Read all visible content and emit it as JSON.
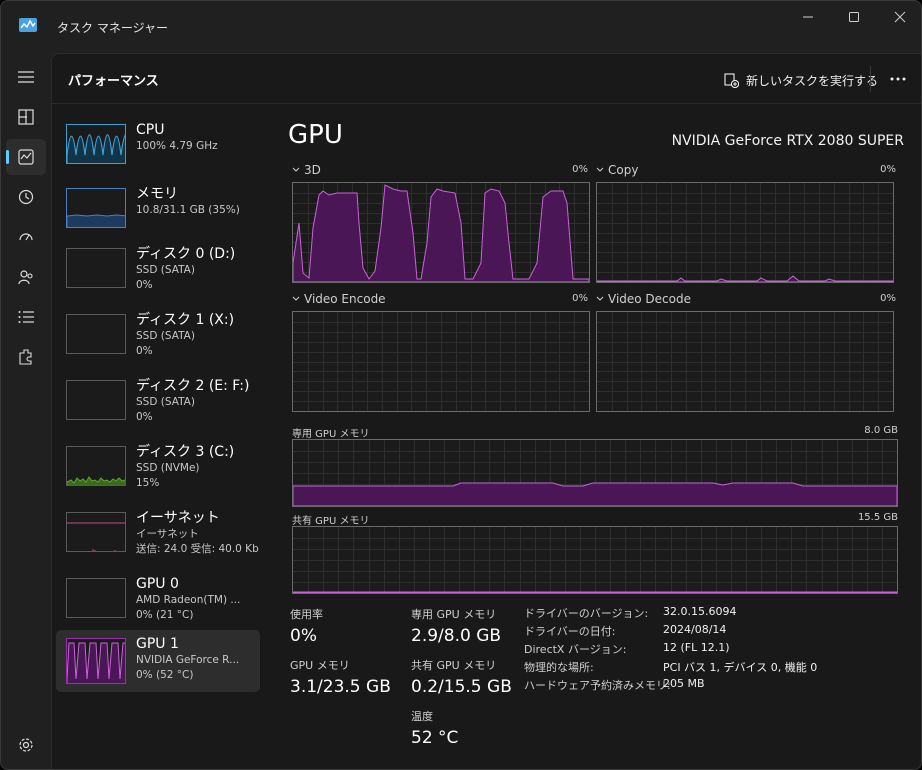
{
  "window": {
    "title": "タスク マネージャー",
    "controls": [
      "minimize-icon",
      "maximize-icon",
      "close-icon"
    ]
  },
  "nav": {
    "items": [
      "hamburger-icon",
      "processes-icon",
      "performance-icon",
      "app-history-icon",
      "startup-apps-icon",
      "users-icon",
      "details-icon",
      "services-icon"
    ],
    "settings": "settings-icon",
    "active": "performance-icon"
  },
  "header": {
    "title": "パフォーマンス",
    "run_task": "新しいタスクを実行する"
  },
  "sidebar": {
    "items": [
      {
        "name": "CPU",
        "sub1": "100%  4.79 GHz",
        "sub2": "",
        "sub3": ""
      },
      {
        "name": "メモリ",
        "sub1": "10.8/31.1 GB (35%)",
        "sub2": "",
        "sub3": ""
      },
      {
        "name": "ディスク 0 (D:)",
        "sub1": "SSD (SATA)",
        "sub2": "0%",
        "sub3": ""
      },
      {
        "name": "ディスク 1 (X:)",
        "sub1": "SSD (SATA)",
        "sub2": "0%",
        "sub3": ""
      },
      {
        "name": "ディスク 2 (E: F:)",
        "sub1": "SSD (SATA)",
        "sub2": "0%",
        "sub3": ""
      },
      {
        "name": "ディスク 3 (C:)",
        "sub1": "SSD (NVMe)",
        "sub2": "15%",
        "sub3": ""
      },
      {
        "name": "イーサネット",
        "sub1": "イーサネット",
        "sub2": "送信: 24.0  受信: 40.0 Kb",
        "sub3": ""
      },
      {
        "name": "GPU 0",
        "sub1": "AMD Radeon(TM) ...",
        "sub2": "0%  (21 °C)",
        "sub3": ""
      },
      {
        "name": "GPU 1",
        "sub1": "NVIDIA GeForce R...",
        "sub2": "0%  (52 °C)",
        "sub3": ""
      }
    ]
  },
  "main": {
    "title": "GPU",
    "model": "NVIDIA GeForce RTX 2080 SUPER",
    "engines": [
      {
        "label": "3D",
        "pct": "0%"
      },
      {
        "label": "Copy",
        "pct": "0%"
      },
      {
        "label": "Video Encode",
        "pct": "0%"
      },
      {
        "label": "Video Decode",
        "pct": "0%"
      }
    ],
    "dedicated": {
      "label": "専用 GPU メモリ",
      "max": "8.0 GB"
    },
    "shared": {
      "label": "共有 GPU メモリ",
      "max": "15.5 GB"
    },
    "stats": {
      "util_label": "使用率",
      "util_value": "0%",
      "gpu_mem_label": "GPU メモリ",
      "gpu_mem_value": "3.1/23.5 GB",
      "ded_label": "専用 GPU メモリ",
      "ded_value": "2.9/8.0 GB",
      "shared_label": "共有 GPU メモリ",
      "shared_value": "0.2/15.5 GB",
      "temp_label": "温度",
      "temp_value": "52 °C"
    },
    "info": [
      {
        "k": "ドライバーのバージョン:",
        "v": "32.0.15.6094"
      },
      {
        "k": "ドライバーの日付:",
        "v": "2024/08/14"
      },
      {
        "k": "DirectX バージョン:",
        "v": "12 (FL 12.1)"
      },
      {
        "k": "物理的な場所:",
        "v": "PCI バス 1, デバイス 0, 機能 0"
      },
      {
        "k": "ハードウェア予約済みメモリ:",
        "v": "205 MB"
      }
    ]
  },
  "colors": {
    "gpu": "#9b2fae",
    "gpu_line": "#c864d8",
    "cpu": "#3d9fd4",
    "memory": "#4a7fc0",
    "disk3": "#5ea82e",
    "ethernet": "#c64a8e",
    "accent": "#60cdff"
  }
}
